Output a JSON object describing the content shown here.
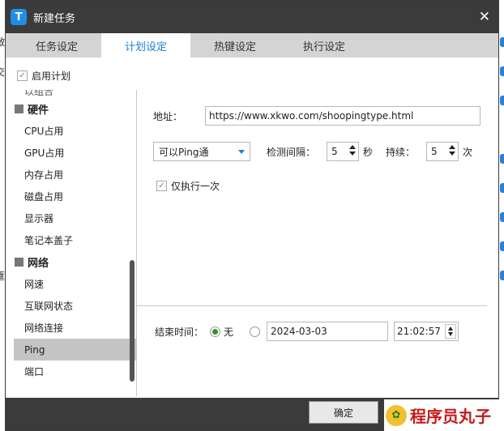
{
  "window": {
    "title": "新建任务",
    "logo_letter": "T",
    "close_glyph": "✕"
  },
  "tabs": [
    {
      "label": "任务设定",
      "active": false
    },
    {
      "label": "计划设定",
      "active": true
    },
    {
      "label": "热键设定",
      "active": false
    },
    {
      "label": "执行设定",
      "active": false
    }
  ],
  "enable_plan": {
    "label": "启用计划",
    "checked": true
  },
  "tree": {
    "partial_item": "以组合",
    "groups": [
      {
        "label": "硬件",
        "items": [
          "CPU占用",
          "GPU占用",
          "内存占用",
          "磁盘占用",
          "显示器",
          "笔记本盖子"
        ]
      },
      {
        "label": "网络",
        "items": [
          "网速",
          "互联网状态",
          "网络连接",
          "Ping",
          "端口"
        ]
      }
    ],
    "selected": "Ping"
  },
  "form": {
    "address_label": "地址：",
    "address_value": "https://www.xkwo.com/shoopingtype.html",
    "mode_value": "可以Ping通",
    "interval_label": "检测间隔：",
    "interval_value": "5",
    "interval_unit": "秒",
    "duration_label": "持续：",
    "duration_value": "5",
    "duration_unit": "次",
    "once_label": "仅执行一次",
    "once_checked": true
  },
  "end_time": {
    "label": "结束时间：",
    "none_label": "无",
    "none_selected": true,
    "date": "2024-03-03",
    "time": "21:02:57"
  },
  "footer": {
    "ok_label": "确定"
  },
  "background": {
    "left_fragments": [
      "敵",
      "交",
      "匯"
    ]
  },
  "watermark": {
    "text": "程序员丸子"
  },
  "colors": {
    "accent": "#1f7fd8",
    "titlebar": "#3b3b3b",
    "radio_on": "#3a8f2a"
  }
}
